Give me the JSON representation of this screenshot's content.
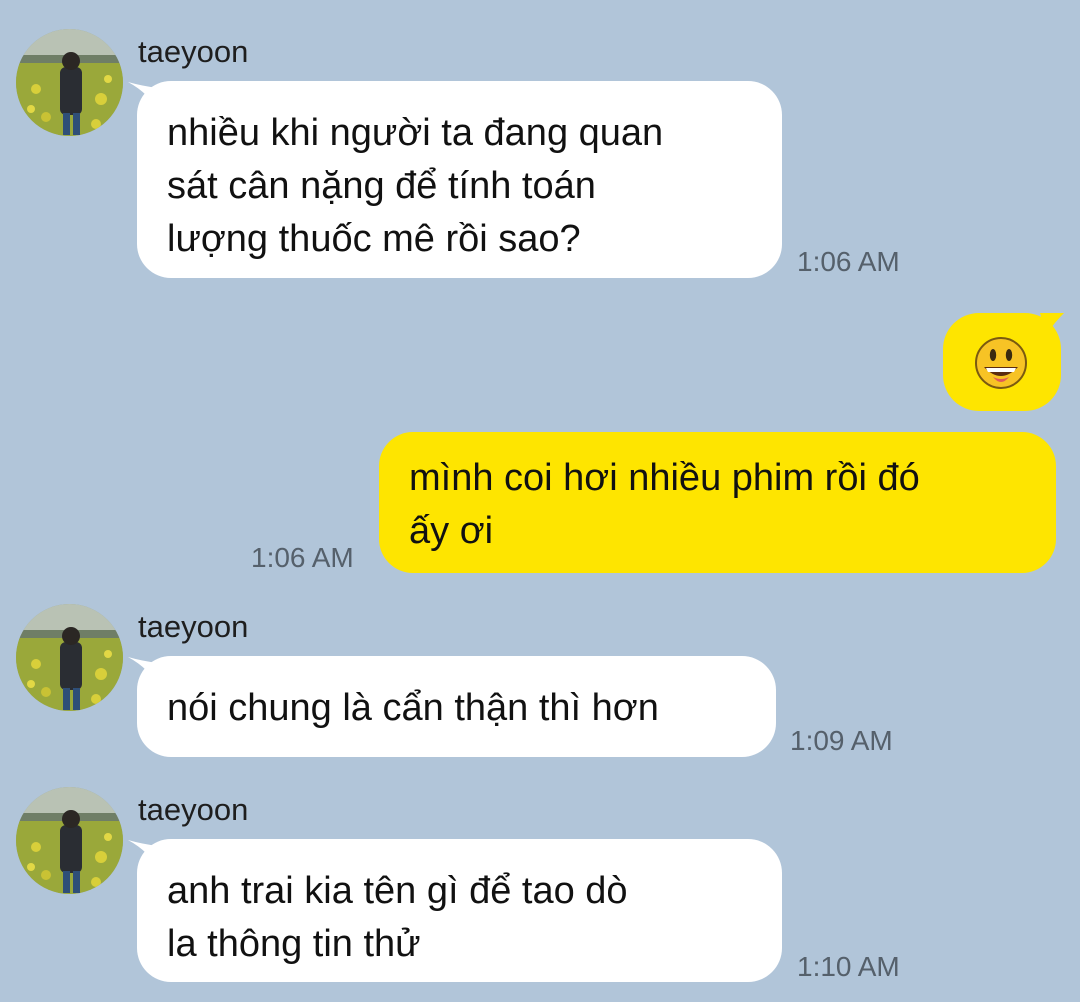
{
  "colors": {
    "background": "#b1c5d9",
    "incoming_bubble": "#ffffff",
    "outgoing_bubble": "#fee500",
    "timestamp": "#55606b"
  },
  "messages": [
    {
      "sender": "taeyoon",
      "lines": [
        "nhiều khi người ta đang quan",
        "sát cân nặng để tính toán",
        "lượng thuốc mê rồi sao?"
      ],
      "time": "1:06 AM"
    },
    {
      "emoji": "grinning-face-icon"
    },
    {
      "lines": [
        "mình coi hơi nhiều phim rồi đó",
        "ấy ơi"
      ],
      "time": "1:06 AM"
    },
    {
      "sender": "taeyoon",
      "lines": [
        "nói chung là cẩn thận thì hơn"
      ],
      "time": "1:09 AM"
    },
    {
      "sender": "taeyoon",
      "lines": [
        "anh trai kia tên gì để tao dò",
        "la thông tin thử"
      ],
      "time": "1:10 AM"
    }
  ]
}
